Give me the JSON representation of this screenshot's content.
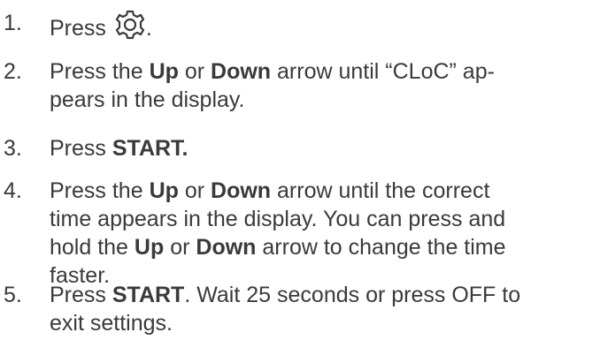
{
  "steps": [
    {
      "number": "1.",
      "press": "Press",
      "icon": "gear-icon",
      "after_icon": "."
    },
    {
      "number": "2.",
      "t1": "Press the",
      "up": "Up",
      "or": "or",
      "down": "Down",
      "t2": "arrow until “CLoC” ap-",
      "line2": "pears in the display."
    },
    {
      "number": "3.",
      "press": "Press",
      "start": "START."
    },
    {
      "number": "4.",
      "t1": "Press the",
      "up": "Up",
      "or": "or",
      "down": "Down",
      "t2": "arrow until the correct",
      "line2": "time appears in the display. You can press and",
      "line3a": "hold the",
      "up2": "Up",
      "or2": "or",
      "down2": "Down",
      "line3b": "arrow to change the time",
      "line4": "faster."
    },
    {
      "number": "5.",
      "press": "Press",
      "start": "START",
      "t2": ". Wait 25 seconds or press OFF to",
      "line2": "exit settings."
    }
  ]
}
